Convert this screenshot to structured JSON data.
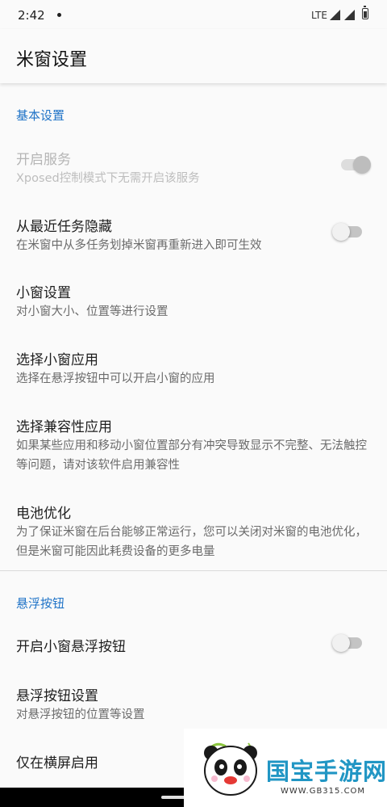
{
  "status_bar": {
    "time": "2:42",
    "network": "LTE"
  },
  "app_bar": {
    "title": "米窗设置"
  },
  "sections": {
    "basic": {
      "header": "基本设置",
      "enable_service": {
        "title": "开启服务",
        "summary": "Xposed控制模式下无需开启该服务",
        "enabled": false,
        "checked": true
      },
      "hide_recents": {
        "title": "从最近任务隐藏",
        "summary": "在米窗中从多任务划掉米窗再重新进入即可生效",
        "checked": false
      },
      "window_settings": {
        "title": "小窗设置",
        "summary": "对小窗大小、位置等进行设置"
      },
      "choose_apps": {
        "title": "选择小窗应用",
        "summary": "选择在悬浮按钮中可以开启小窗的应用"
      },
      "compat_apps": {
        "title": "选择兼容性应用",
        "summary": "如果某些应用和移动小窗位置部分有冲突导致显示不完整、无法触控等问题，请对该软件启用兼容性"
      },
      "battery": {
        "title": "电池优化",
        "summary": "为了保证米窗在后台能够正常运行，您可以关闭对米窗的电池优化，但是米窗可能因此耗费设备的更多电量"
      }
    },
    "floating": {
      "header": "悬浮按钮",
      "enable_floating": {
        "title": "开启小窗悬浮按钮",
        "checked": false
      },
      "floating_settings": {
        "title": "悬浮按钮设置",
        "summary": "对悬浮按钮的位置等设置"
      },
      "landscape_only": {
        "title": "仅在横屏启用"
      }
    }
  },
  "watermark": {
    "brand": "国宝手游网",
    "url": "WWW.GB315.COM"
  },
  "colors": {
    "accent": "#1f73c7",
    "background": "#fafafa",
    "watermark_blue": "#2196c4"
  }
}
